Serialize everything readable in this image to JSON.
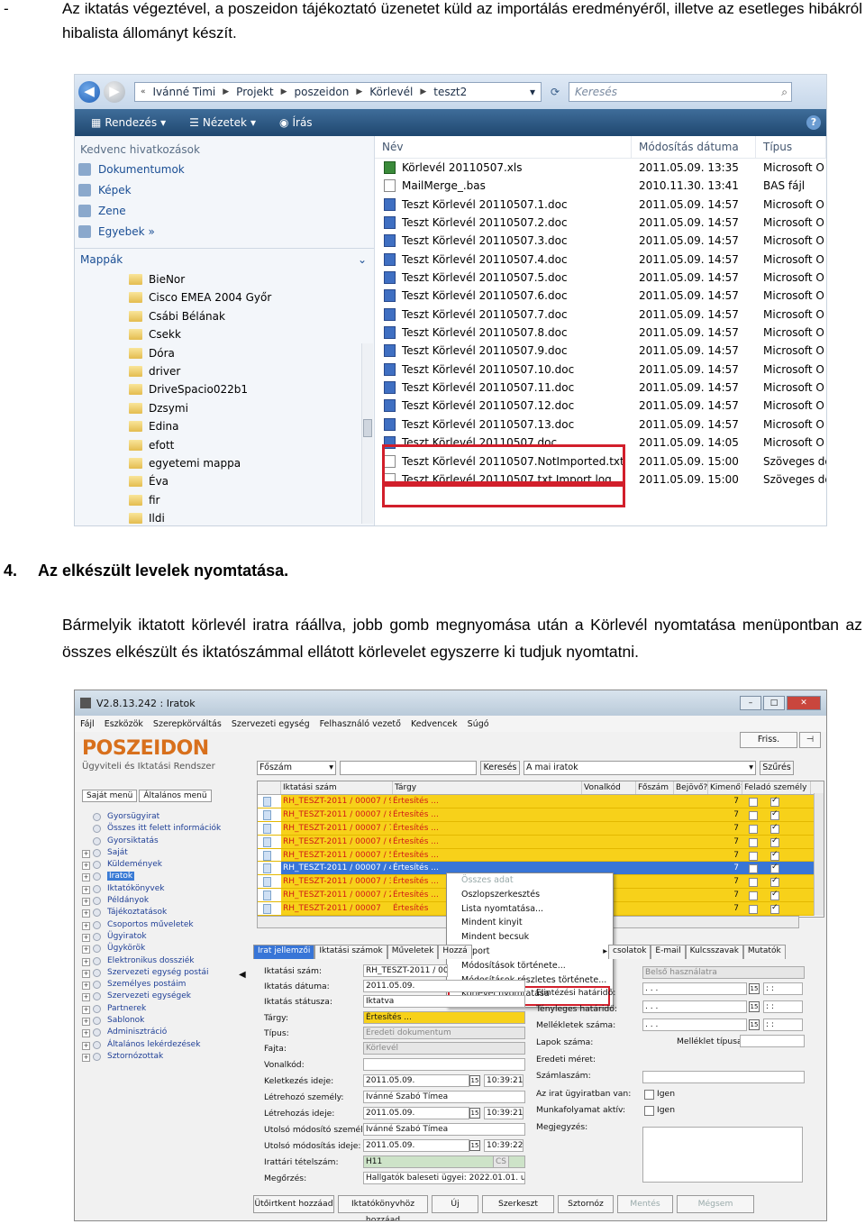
{
  "doc": {
    "bullet": "-",
    "para1": "Az iktatás végeztével, a poszeidon tájékoztató üzenetet küld az importálás eredményéről, illetve az esetleges hibákról hibalista állományt készít.",
    "section_num": "4.",
    "section_title": "Az elkészült levelek nyomtatása.",
    "para2": "Bármelyik iktatott körlevél iratra ráállva, jobb gomb megnyomása után a Körlevél nyomtatása menüpontban az összes elkészült és iktatószámmal ellátott körlevelet egyszerre ki tudjuk nyomtatni."
  },
  "explorer": {
    "breadcrumb": [
      "Ivánné Timi",
      "Projekt",
      "poszeidon",
      "Körlevél",
      "teszt2"
    ],
    "search_placeholder": "Keresés",
    "toolbar": [
      "Rendezés",
      "Nézetek",
      "Írás"
    ],
    "favorites_heading": "Kedvenc hivatkozások",
    "favorites": [
      "Dokumentumok",
      "Képek",
      "Zene",
      "Egyebek »"
    ],
    "folders_heading": "Mappák",
    "folders": [
      "BieNor",
      "Cisco EMEA 2004 Győr",
      "Csábi Bélának",
      "Csekk",
      "Dóra",
      "driver",
      "DriveSpacio022b1",
      "Dzsymi",
      "Edina",
      "efott",
      "egyetemi mappa",
      "Éva",
      "fir",
      "Ildi"
    ],
    "columns": [
      "Név",
      "Módosítás dátuma",
      "Típus"
    ],
    "files": [
      {
        "name": "Körlevél 20110507.xls",
        "date": "2011.05.09. 13:35",
        "type": "Microsoft O",
        "icon": "excel-icon"
      },
      {
        "name": "MailMerge_.bas",
        "date": "2010.11.30. 13:41",
        "type": "BAS fájl",
        "icon": "file-icon"
      },
      {
        "name": "Teszt Körlevél 20110507.1.doc",
        "date": "2011.05.09. 14:57",
        "type": "Microsoft O",
        "icon": "word-icon"
      },
      {
        "name": "Teszt Körlevél 20110507.2.doc",
        "date": "2011.05.09. 14:57",
        "type": "Microsoft O",
        "icon": "word-icon"
      },
      {
        "name": "Teszt Körlevél 20110507.3.doc",
        "date": "2011.05.09. 14:57",
        "type": "Microsoft O",
        "icon": "word-icon"
      },
      {
        "name": "Teszt Körlevél 20110507.4.doc",
        "date": "2011.05.09. 14:57",
        "type": "Microsoft O",
        "icon": "word-icon"
      },
      {
        "name": "Teszt Körlevél 20110507.5.doc",
        "date": "2011.05.09. 14:57",
        "type": "Microsoft O",
        "icon": "word-icon"
      },
      {
        "name": "Teszt Körlevél 20110507.6.doc",
        "date": "2011.05.09. 14:57",
        "type": "Microsoft O",
        "icon": "word-icon"
      },
      {
        "name": "Teszt Körlevél 20110507.7.doc",
        "date": "2011.05.09. 14:57",
        "type": "Microsoft O",
        "icon": "word-icon"
      },
      {
        "name": "Teszt Körlevél 20110507.8.doc",
        "date": "2011.05.09. 14:57",
        "type": "Microsoft O",
        "icon": "word-icon"
      },
      {
        "name": "Teszt Körlevél 20110507.9.doc",
        "date": "2011.05.09. 14:57",
        "type": "Microsoft O",
        "icon": "word-icon"
      },
      {
        "name": "Teszt Körlevél 20110507.10.doc",
        "date": "2011.05.09. 14:57",
        "type": "Microsoft O",
        "icon": "word-icon"
      },
      {
        "name": "Teszt Körlevél 20110507.11.doc",
        "date": "2011.05.09. 14:57",
        "type": "Microsoft O",
        "icon": "word-icon"
      },
      {
        "name": "Teszt Körlevél 20110507.12.doc",
        "date": "2011.05.09. 14:57",
        "type": "Microsoft O",
        "icon": "word-icon"
      },
      {
        "name": "Teszt Körlevél 20110507.13.doc",
        "date": "2011.05.09. 14:57",
        "type": "Microsoft O",
        "icon": "word-icon"
      },
      {
        "name": "Teszt Körlevél 20110507.doc",
        "date": "2011.05.09. 14:05",
        "type": "Microsoft O",
        "icon": "word-icon"
      },
      {
        "name": "Teszt Körlevél 20110507.NotImported.txt",
        "date": "2011.05.09. 15:00",
        "type": "Szöveges do",
        "icon": "text-file-icon"
      },
      {
        "name": "Teszt Körlevél 20110507.txt.Import.log",
        "date": "2011.05.09. 15:00",
        "type": "Szöveges do",
        "icon": "text-file-icon"
      }
    ]
  },
  "poszeidon": {
    "window_title": "V2.8.13.242 : Iratok",
    "menu": [
      "Fájl",
      "Eszközök",
      "Szerepkörváltás",
      "Szervezeti egység",
      "Felhasználó vezető",
      "Kedvencek",
      "Súgó"
    ],
    "logo": "POSZEIDON",
    "logo_sub": "Ügyviteli és Iktatási Rendszer",
    "side_tabs": [
      "Saját menü",
      "Általános menü"
    ],
    "tree": [
      "Gyorsügyirat",
      "Összes itt felett információk",
      "Gyorsiktatás",
      "Saját",
      "Küldemények",
      "Iratok",
      "Iktatókönyvek",
      "Példányok",
      "Tájékoztatások",
      "Csoportos műveletek",
      "Ügyiratok",
      "Ügykörök",
      "Elektronikus dossziék",
      "Szervezeti egység postái",
      "Személyes postáim",
      "Szervezeti egységek",
      "Partnerek",
      "Sablonok",
      "Adminisztráció",
      "Általános lekérdezések",
      "Sztornózottak"
    ],
    "refresh_btn": "Friss.",
    "search_field": "Főszám",
    "search_btn": "Keresés",
    "scope": "A mai iratok",
    "filter_btn": "Szűrés",
    "grid_cols": [
      "Iktatási szám",
      "Tárgy",
      "Vonalkód",
      "Főszám",
      "Bejövő?",
      "Kimenő?",
      "Feladó személy"
    ],
    "grid_rows": [
      {
        "id": "RH_TESZT-2011 / 00007 / 9",
        "subj": "Értesítés ...",
        "n": "7",
        "sel": false
      },
      {
        "id": "RH_TESZT-2011 / 00007 / 8",
        "subj": "Értesítés ...",
        "n": "7",
        "sel": false
      },
      {
        "id": "RH_TESZT-2011 / 00007 / 7",
        "subj": "Értesítés ...",
        "n": "7",
        "sel": false
      },
      {
        "id": "RH_TESZT-2011 / 00007 / 6",
        "subj": "Értesítés ...",
        "n": "7",
        "sel": false
      },
      {
        "id": "RH_TESZT-2011 / 00007 / 5",
        "subj": "Értesítés ...",
        "n": "7",
        "sel": false
      },
      {
        "id": "RH_TESZT-2011 / 00007 / 4",
        "subj": "Értesítés ...",
        "n": "7",
        "sel": true
      },
      {
        "id": "RH_TESZT-2011 / 00007 / 3",
        "subj": "Értesítés ...",
        "n": "7",
        "sel": false
      },
      {
        "id": "RH_TESZT-2011 / 00007 / 2",
        "subj": "Értesítés ...",
        "n": "7",
        "sel": false
      },
      {
        "id": "RH_TESZT-2011 / 00007",
        "subj": "Értesítés",
        "n": "7",
        "sel": false
      }
    ],
    "context_menu": [
      "Összes adat",
      "Oszlopszerkesztés",
      "Lista nyomtatása...",
      "Mindent kinyit",
      "Mindent becsuk",
      "Import",
      "Módosítások története...",
      "Módosítások részletes története...",
      "Körlevél nyomtatása"
    ],
    "detail_tabs_left": [
      "Irat jellemzői",
      "Iktatási számok",
      "Műveletek",
      "Hozzá"
    ],
    "detail_tabs_right": [
      "csolatok",
      "E-mail",
      "Kulcsszavak",
      "Mutatók"
    ],
    "form_left_labels": [
      "Iktatási szám:",
      "Iktatás dátuma:",
      "Iktatás státusza:",
      "Tárgy:",
      "Típus:",
      "Fajta:",
      "Vonalkód:",
      "Keletkezés ideje:",
      "Létrehozó személy:",
      "Létrehozás ideje:",
      "Utolsó módosító személy:",
      "Utolsó módosítás ideje:",
      "Irattári tételszám:",
      "Megőrzés:"
    ],
    "form_left_values": [
      "RH_TESZT-2011 / 00",
      "2011.05.09.",
      "Iktatva",
      "Értesítés ...",
      "Eredeti dokumentum",
      "Körlevél",
      "",
      "2011.05.09.",
      "Ivánné Szabó Tímea",
      "2011.05.09.",
      "Ivánné Szabó Tímea",
      "2011.05.09.",
      "H11",
      "Hallgatók baleseti ügyei: 2022.01.01. után sel"
    ],
    "times": [
      "10:39:21",
      "10:39:21",
      "10:39:22"
    ],
    "cs_label": "CS",
    "form_mid_labels": [
      "Elintézési határidő:",
      "Tényleges határidő:",
      "Mellékletek száma:",
      "Lapok száma:",
      "Eredeti méret:",
      "Számlaszám:",
      "Az irat ügyiratban van:",
      "Munkafolyamat aktív:",
      "Megjegyzés:"
    ],
    "beso": "Belső használatra",
    "dots": ". . .",
    "melleklet_tipus": "Melléklet típusa:",
    "igen": "Igen",
    "buttons": [
      "Ütőirtkent hozzáad",
      "Iktatókönyvhöz hozzáad",
      "Új",
      "Szerkeszt",
      "Sztornóz",
      "Mentés",
      "Mégsem"
    ]
  }
}
